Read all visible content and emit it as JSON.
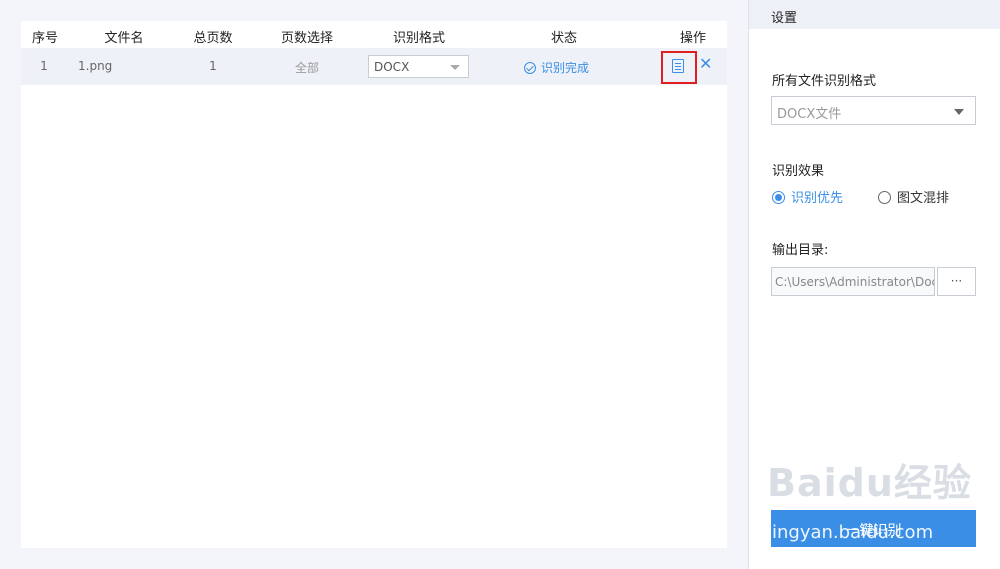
{
  "table": {
    "headers": [
      "序号",
      "文件名",
      "总页数",
      "页数选择",
      "识别格式",
      "状态",
      "操作"
    ],
    "rows": [
      {
        "index": "1",
        "filename": "1.png",
        "total_pages": "1",
        "page_selection": "全部",
        "format": "DOCX",
        "status": "识别完成"
      }
    ]
  },
  "icons": {
    "status": "check-circle-icon",
    "view": "document-icon",
    "remove": "close-icon"
  },
  "settings": {
    "title": "设置",
    "format_label": "所有文件识别格式",
    "format_value": "DOCX文件",
    "effect_label": "识别效果",
    "effect_options": [
      {
        "label": "识别优先",
        "checked": true
      },
      {
        "label": "图文混排",
        "checked": false
      }
    ],
    "output_label": "输出目录:",
    "output_path": "C:\\Users\\Administrator\\Docu",
    "browse_label": "···",
    "start_button": "一键识别"
  },
  "watermark": {
    "logo": "Baidu经验",
    "url": "jingyan.baidu.com"
  },
  "colors": {
    "accent": "#3a8ee6",
    "highlight_box": "#e02020",
    "row_bg": "#eef2f8",
    "page_bg": "#f3f5fa"
  }
}
